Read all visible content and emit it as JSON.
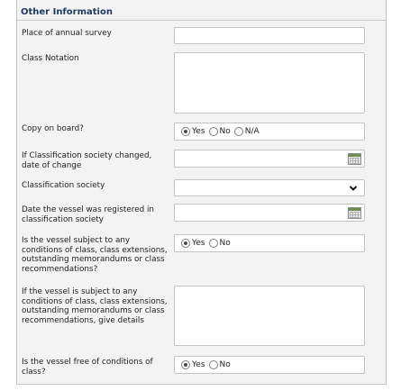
{
  "section": {
    "title": "Other Information"
  },
  "fields": {
    "annual_survey_place": {
      "label": "Place of annual survey",
      "value": ""
    },
    "class_notation": {
      "label": "Class Notation",
      "value": ""
    },
    "copy_on_board": {
      "label": "Copy on board?",
      "options": [
        "Yes",
        "No",
        "N/A"
      ],
      "selected": "Yes"
    },
    "class_society_changed": {
      "label": "If Classification society changed, date of change",
      "value": ""
    },
    "classification_society": {
      "label": "Classification society",
      "selected": ""
    },
    "date_registered": {
      "label": "Date the vessel was registered in classification society",
      "value": ""
    },
    "subject_to_conditions": {
      "label": "Is the vessel subject to any conditions of class, class extensions, outstanding memorandums or class recommendations?",
      "options": [
        "Yes",
        "No"
      ],
      "selected": "Yes"
    },
    "conditions_details": {
      "label": "If the vessel is subject to any conditions of class, class extensions, outstanding memorandums or class recommendations, give details",
      "value": ""
    },
    "free_of_conditions": {
      "label": "Is the vessel free of conditions of class?",
      "options": [
        "Yes",
        "No"
      ],
      "selected": "Yes"
    }
  },
  "icons": {
    "calendar": "calendar-icon",
    "dropdown": "chevron-down-icon"
  },
  "colors": {
    "title": "#1f3b63",
    "panel_bg": "#f3f3f3",
    "field_border": "#c3c3c3"
  }
}
